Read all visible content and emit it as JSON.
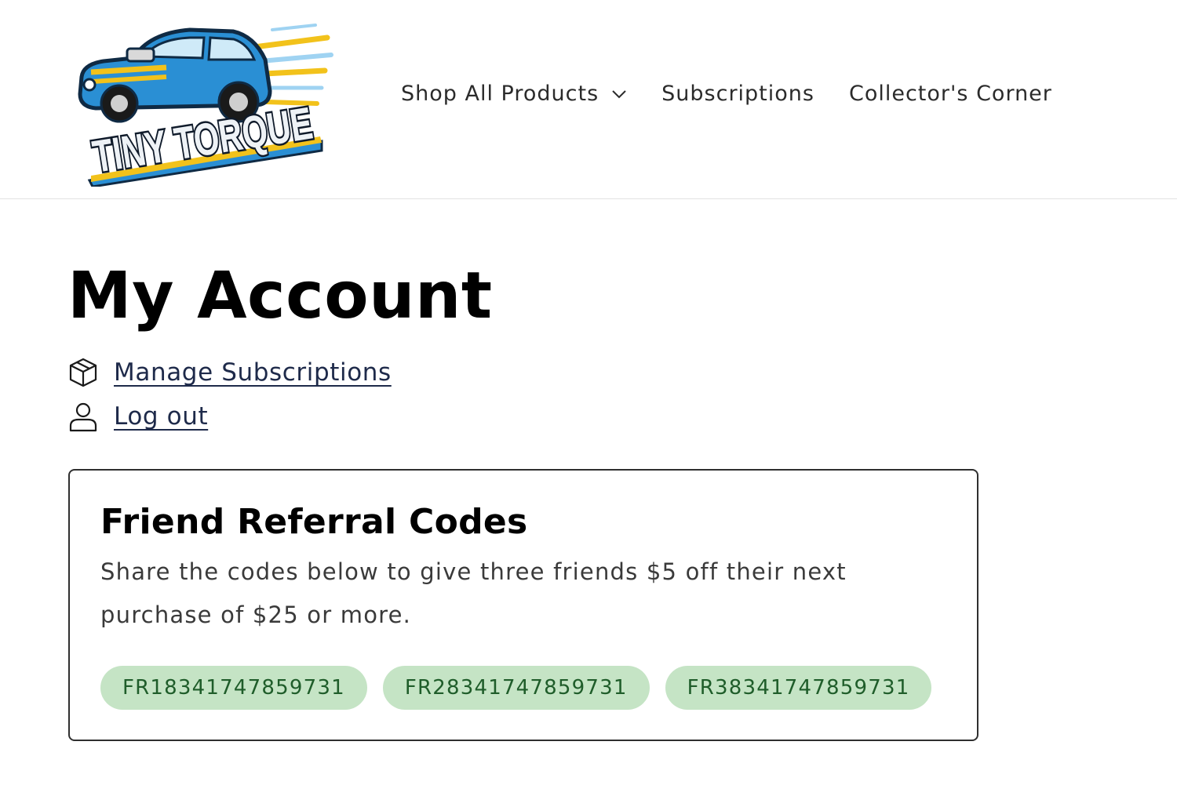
{
  "header": {
    "logo": {
      "text": "TINY TORQUE"
    },
    "nav": [
      {
        "label": "Shop All Products",
        "has_dropdown": true
      },
      {
        "label": "Subscriptions"
      },
      {
        "label": "Collector's Corner"
      }
    ]
  },
  "main": {
    "title": "My Account",
    "links": [
      {
        "label": "Manage Subscriptions",
        "icon": "package-icon"
      },
      {
        "label": "Log out",
        "icon": "user-icon"
      }
    ],
    "referral": {
      "title": "Friend Referral Codes",
      "description": "Share the codes below to give three friends $5 off their next purchase of $25 or more.",
      "codes": [
        "FR18341747859731",
        "FR28341747859731",
        "FR38341747859731"
      ]
    }
  },
  "colors": {
    "code_bg": "#c5e4c5",
    "code_text": "#1f5d2a",
    "link_text": "#1e2a4a",
    "logo_blue": "#2a8fd4",
    "logo_yellow": "#f2c21b"
  }
}
